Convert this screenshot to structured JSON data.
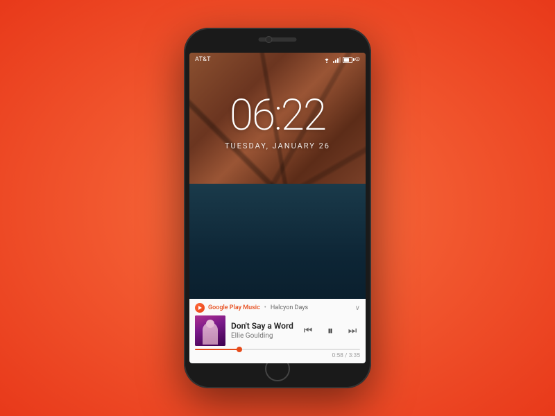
{
  "phone": {
    "status": {
      "carrier": "AT&T",
      "time": "06:22",
      "date": "TUESDAY, JANUARY 26"
    },
    "music": {
      "app_name": "Google Play Music",
      "playlist": "Halcyon Days",
      "track_title": "Don't Say a Word",
      "track_artist": "Ellie Goulding",
      "current_time": "0:58",
      "total_time": "3:35",
      "progress_percent": 27,
      "chevron": "∨"
    },
    "controls": {
      "rewind": "⏮",
      "pause": "⏸",
      "forward": "⏭"
    }
  }
}
